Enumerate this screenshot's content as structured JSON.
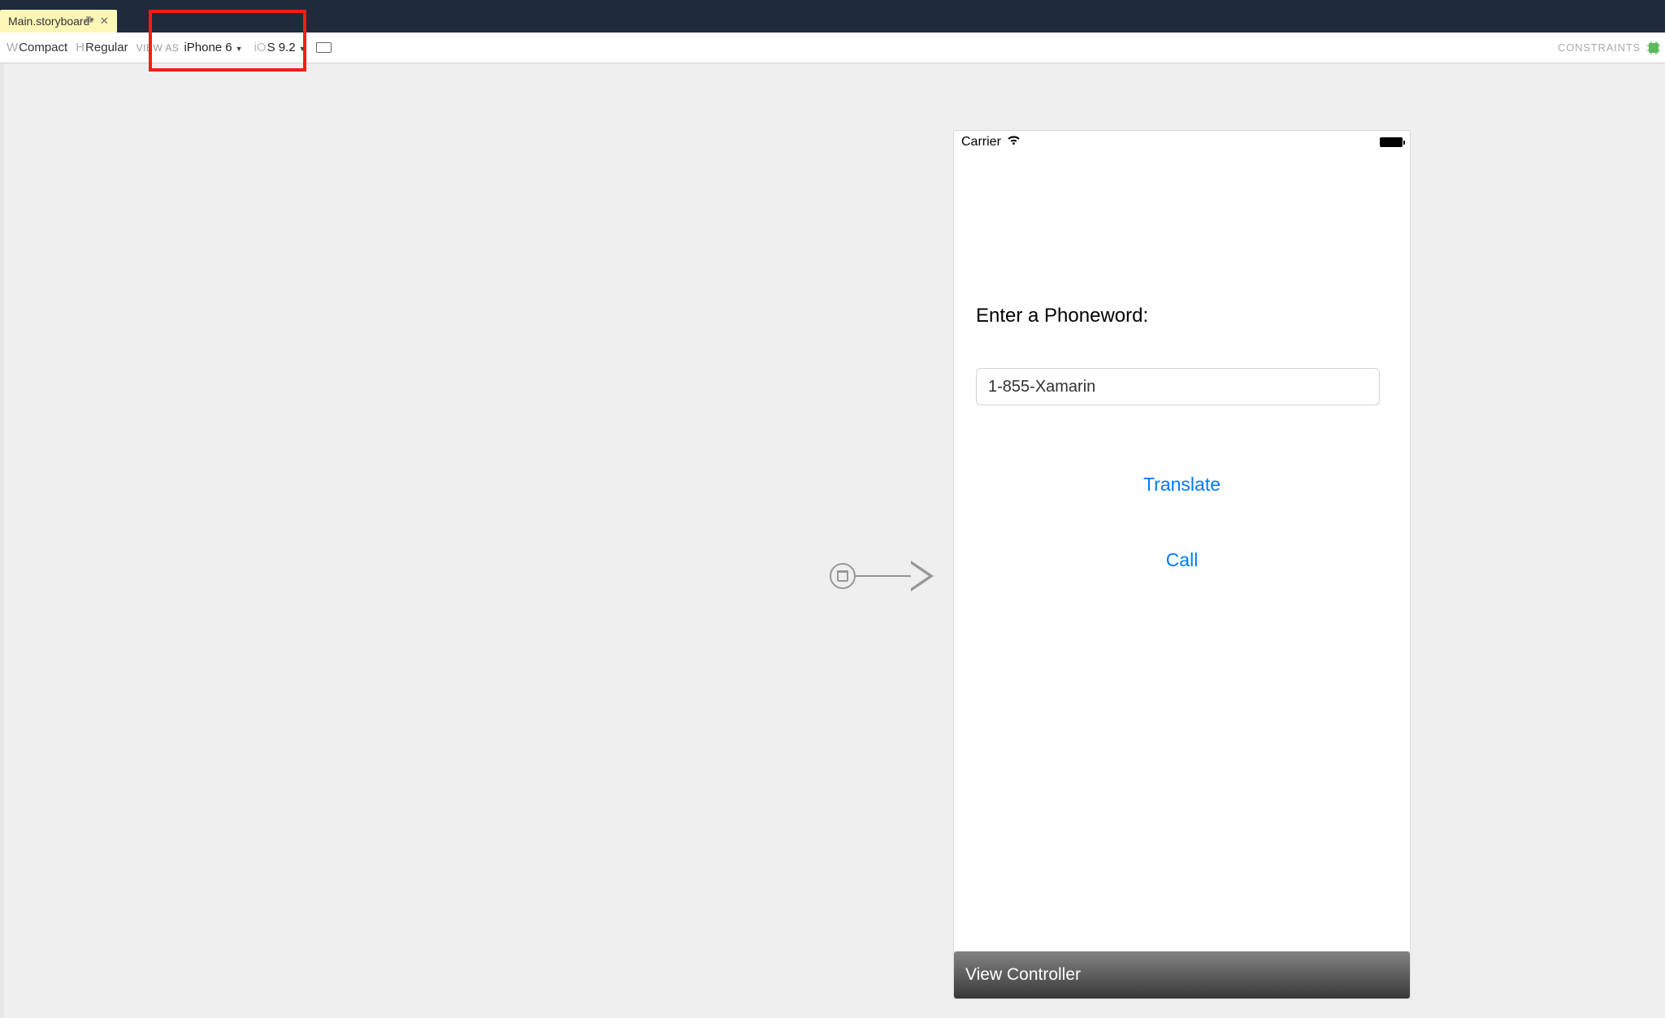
{
  "tab": {
    "title": "Main.storyboard*"
  },
  "toolbar": {
    "size_w_prefix": "W",
    "size_w_val": "Compact",
    "size_h_prefix": "H",
    "size_h_val": "Regular",
    "view_as_label": "VIEW AS",
    "device": "iPhone 6",
    "ios_prefix": "iO",
    "ios_version": "S 9.2",
    "constraints_label": "CONSTRAINTS"
  },
  "device": {
    "status_carrier": "Carrier",
    "content": {
      "prompt": "Enter a Phoneword:",
      "text_value": "1-855-Xamarin",
      "translate_btn": "Translate",
      "call_btn": "Call"
    },
    "bottom_bar": "View Controller"
  }
}
